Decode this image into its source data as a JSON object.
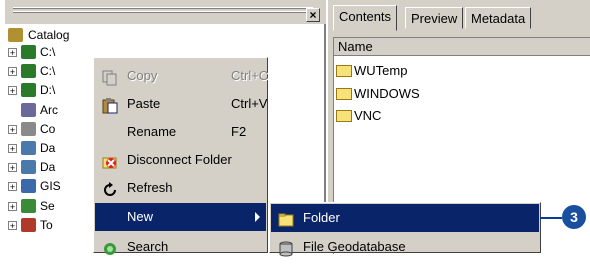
{
  "catalog": {
    "root_label": "Catalog",
    "items": [
      {
        "label": "C:\\",
        "icon": "drive-icon",
        "color": "#2a7a2a"
      },
      {
        "label": "C:\\",
        "icon": "drive-icon",
        "color": "#2a7a2a"
      },
      {
        "label": "D:\\",
        "icon": "drive-icon",
        "color": "#2a7a2a"
      },
      {
        "label": "Arc",
        "icon": "toolbox-icon",
        "color": "#6a6a9a"
      },
      {
        "label": "Co",
        "icon": "coordinate-system-icon",
        "color": "#8a8a8a"
      },
      {
        "label": "Da",
        "icon": "database-connection-icon",
        "color": "#4a7aaa"
      },
      {
        "label": "Da",
        "icon": "database-server-icon",
        "color": "#4a7aaa"
      },
      {
        "label": "GIS",
        "icon": "gis-server-icon",
        "color": "#3a6aaa"
      },
      {
        "label": "Se",
        "icon": "search-results-icon",
        "color": "#3a8a3a"
      },
      {
        "label": "To",
        "icon": "toolboxes-icon",
        "color": "#b03a2a"
      }
    ]
  },
  "tabs": [
    {
      "label": "Contents",
      "active": true
    },
    {
      "label": "Preview",
      "active": false
    },
    {
      "label": "Metadata",
      "active": false
    }
  ],
  "contents": {
    "column_header": "Name",
    "files": [
      "WUTemp",
      "WINDOWS",
      "VNC"
    ]
  },
  "context_menu": {
    "items": [
      {
        "label": "Copy",
        "shortcut": "Ctrl+C",
        "disabled": true,
        "icon": "copy-icon"
      },
      {
        "label": "Paste",
        "shortcut": "Ctrl+V",
        "disabled": false,
        "icon": "paste-icon"
      },
      {
        "label": "Rename",
        "shortcut": "F2",
        "disabled": false,
        "icon": ""
      },
      {
        "label": "Disconnect Folder",
        "shortcut": "",
        "disabled": false,
        "icon": "disconnect-folder-icon"
      },
      {
        "label": "Refresh",
        "shortcut": "",
        "disabled": false,
        "icon": "refresh-icon"
      },
      {
        "label": "New",
        "shortcut": "",
        "disabled": false,
        "icon": "",
        "highlighted": true
      },
      {
        "label": "Search",
        "shortcut": "",
        "disabled": false,
        "icon": "search-icon"
      }
    ]
  },
  "submenu": {
    "items": [
      {
        "label": "Folder",
        "highlighted": true,
        "icon": "folder-icon"
      },
      {
        "label": "File Geodatabase",
        "highlighted": false,
        "icon": "file-geodatabase-icon"
      }
    ]
  },
  "callout": {
    "number": "3"
  },
  "colors": {
    "highlight": "#0a246a",
    "menu_bg": "#d4d0c8",
    "callout": "#1a4fa0"
  }
}
